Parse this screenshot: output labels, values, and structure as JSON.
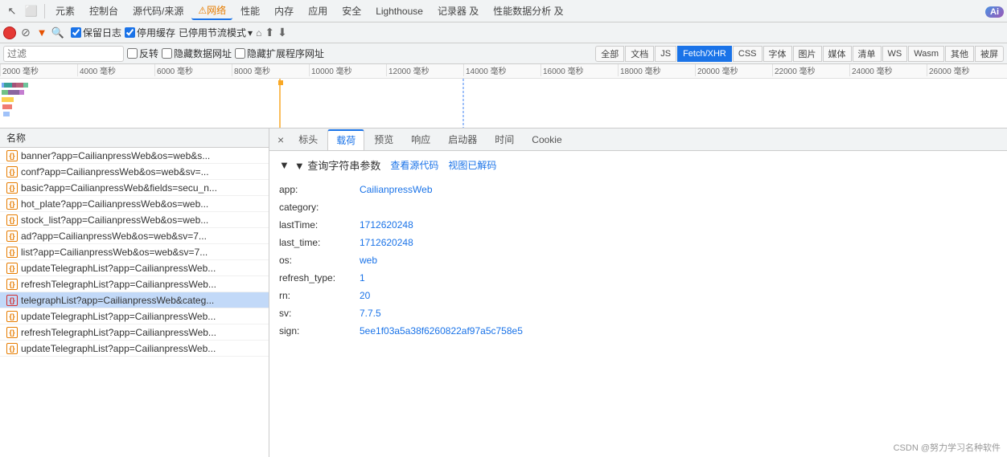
{
  "devtools": {
    "tabs": [
      {
        "id": "elements",
        "label": "元素"
      },
      {
        "id": "console",
        "label": "控制台"
      },
      {
        "id": "sources",
        "label": "源代码/来源"
      },
      {
        "id": "network",
        "label": "网络",
        "active": true,
        "warning": true
      },
      {
        "id": "performance",
        "label": "性能"
      },
      {
        "id": "memory",
        "label": "内存"
      },
      {
        "id": "application",
        "label": "应用"
      },
      {
        "id": "security",
        "label": "安全"
      },
      {
        "id": "lighthouse",
        "label": "Lighthouse"
      },
      {
        "id": "recorder",
        "label": "记录器 及"
      },
      {
        "id": "perf-insights",
        "label": "性能数据分析 及"
      }
    ],
    "ai_label": "Ai"
  },
  "network_toolbar": {
    "preserve_log": "保留日志",
    "disable_cache": "停用缓存",
    "throttle": "已停用节流模式",
    "upload_icon": "⬆",
    "download_icon": "⬇"
  },
  "filter_bar": {
    "placeholder": "过滤",
    "invert": "反转",
    "hide_data_urls": "隐藏数据网址",
    "hide_extension_urls": "隐藏扩展程序网址",
    "type_buttons": [
      {
        "id": "all",
        "label": "全部",
        "active": false
      },
      {
        "id": "doc",
        "label": "文档",
        "active": false
      },
      {
        "id": "js",
        "label": "JS",
        "active": false
      },
      {
        "id": "fetch",
        "label": "Fetch/XHR",
        "active": true
      },
      {
        "id": "css",
        "label": "CSS",
        "active": false
      },
      {
        "id": "font",
        "label": "字体",
        "active": false
      },
      {
        "id": "img",
        "label": "图片",
        "active": false
      },
      {
        "id": "media",
        "label": "媒体",
        "active": false
      },
      {
        "id": "manifest",
        "label": "清单",
        "active": false
      },
      {
        "id": "ws",
        "label": "WS",
        "active": false
      },
      {
        "id": "wasm",
        "label": "Wasm",
        "active": false
      },
      {
        "id": "other",
        "label": "其他",
        "active": false
      },
      {
        "id": "blocked",
        "label": "被屏",
        "active": false
      }
    ]
  },
  "timeline": {
    "marks": [
      "2000 毫秒",
      "4000 毫秒",
      "6000 毫秒",
      "8000 毫秒",
      "10000 毫秒",
      "12000 毫秒",
      "14000 毫秒",
      "16000 毫秒",
      "18000 毫秒",
      "20000 毫秒",
      "22000 毫秒",
      "24000 毫秒",
      "26000 毫秒"
    ]
  },
  "request_list": {
    "header": "名称",
    "items": [
      {
        "id": "banner",
        "name": "banner?app=CailianpressWeb&os=web&s...",
        "type": "orange"
      },
      {
        "id": "conf",
        "name": "conf?app=CailianpressWeb&os=web&sv=...",
        "type": "orange"
      },
      {
        "id": "basic",
        "name": "basic?app=CailianpressWeb&fields=secu_n...",
        "type": "orange"
      },
      {
        "id": "hot_plate",
        "name": "hot_plate?app=CailianpressWeb&os=web...",
        "type": "orange"
      },
      {
        "id": "stock_list",
        "name": "stock_list?app=CailianpressWeb&os=web...",
        "type": "orange"
      },
      {
        "id": "ad",
        "name": "ad?app=CailianpressWeb&os=web&sv=7...",
        "type": "orange"
      },
      {
        "id": "list",
        "name": "list?app=CailianpressWeb&os=web&sv=7...",
        "type": "orange"
      },
      {
        "id": "updateTelegraph",
        "name": "updateTelegraphList?app=CailianpressWeb...",
        "type": "orange"
      },
      {
        "id": "refreshTelegraph",
        "name": "refreshTelegraphList?app=CailianpressWeb...",
        "type": "orange"
      },
      {
        "id": "telegraphList",
        "name": "telegraphList?app=CailianpressWeb&categ...",
        "type": "red",
        "selected": true
      },
      {
        "id": "updateTelegraph2",
        "name": "updateTelegraphList?app=CailianpressWeb...",
        "type": "orange"
      },
      {
        "id": "refreshTelegraph2",
        "name": "refreshTelegraphList?app=CailianpressWeb...",
        "type": "orange"
      },
      {
        "id": "updateTelegraph3",
        "name": "updateTelegraphList?app=CailianpressWeb...",
        "type": "orange"
      }
    ]
  },
  "detail_panel": {
    "tabs": [
      {
        "id": "close",
        "label": "×"
      },
      {
        "id": "headers",
        "label": "标头"
      },
      {
        "id": "payload",
        "label": "载荷",
        "active": true
      },
      {
        "id": "preview",
        "label": "预览"
      },
      {
        "id": "response",
        "label": "响应"
      },
      {
        "id": "initiator",
        "label": "启动器"
      },
      {
        "id": "timing",
        "label": "时间"
      },
      {
        "id": "cookies",
        "label": "Cookie"
      }
    ],
    "query_params": {
      "title": "▼ 查询字符串参数",
      "view_source": "查看源代码",
      "view_decoded": "视图已解码",
      "params": [
        {
          "key": "app",
          "value": "CailianpressWeb"
        },
        {
          "key": "category",
          "value": ""
        },
        {
          "key": "lastTime",
          "value": "1712620248"
        },
        {
          "key": "last_time",
          "value": "1712620248"
        },
        {
          "key": "os",
          "value": "web"
        },
        {
          "key": "refresh_type",
          "value": "1"
        },
        {
          "key": "rn",
          "value": "20"
        },
        {
          "key": "sv",
          "value": "7.7.5"
        },
        {
          "key": "sign",
          "value": "5ee1f03a5a38f6260822af97a5c758e5"
        }
      ]
    }
  },
  "watermark": "CSDN @努力学习名种软件"
}
